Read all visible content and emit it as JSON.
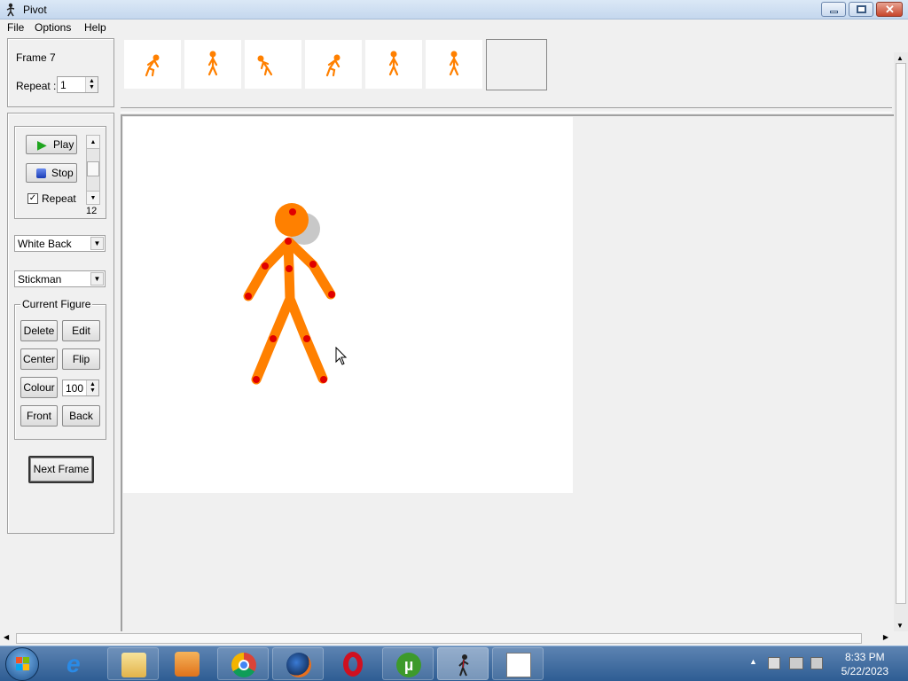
{
  "window": {
    "title": "Pivot"
  },
  "menu": {
    "items": [
      {
        "label": "File"
      },
      {
        "label": "Options"
      },
      {
        "label": "Help"
      }
    ]
  },
  "frame_info": {
    "frame_label": "Frame 7",
    "repeat_label": "Repeat :",
    "repeat_value": "1"
  },
  "playback": {
    "play_label": "Play",
    "stop_label": "Stop",
    "repeat_label": "Repeat",
    "repeat_checked": true,
    "speed_value": "12"
  },
  "background_select": {
    "value": "White Back"
  },
  "figure_select": {
    "value": "Stickman"
  },
  "current_figure": {
    "legend": "Current Figure",
    "delete_label": "Delete",
    "edit_label": "Edit",
    "center_label": "Center",
    "flip_label": "Flip",
    "colour_label": "Colour",
    "colour_value": "100",
    "front_label": "Front",
    "back_label": "Back"
  },
  "next_frame_label": "Next Frame",
  "figure_color": "#ff8000",
  "joint_color": "#e00000",
  "timeline": {
    "frame_count": 6,
    "has_empty_slot": true
  },
  "taskbar": {
    "apps": [
      "start-orb",
      "internet-explorer",
      "file-explorer",
      "media-player",
      "chrome",
      "firefox",
      "opera",
      "utorrent",
      "pivot",
      "task-manager"
    ],
    "time": "8:33 PM",
    "date": "5/22/2023"
  }
}
